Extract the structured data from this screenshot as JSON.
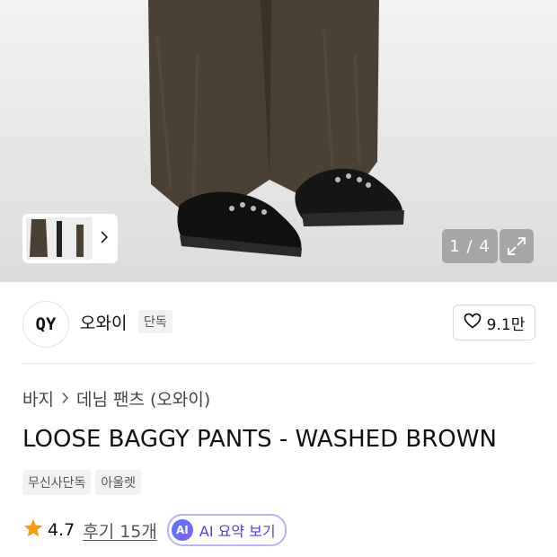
{
  "gallery": {
    "counter": "1 / 4",
    "thumbnail_icon": "product-thumbnail",
    "next_icon": "chevron-right-icon",
    "expand_icon": "expand-icon"
  },
  "brand": {
    "logo_text": "QY",
    "name": "오와이",
    "badge": "단독",
    "like_count": "9.1만",
    "like_icon": "heart-icon"
  },
  "breadcrumb": {
    "items": [
      "바지",
      "데님 팬츠 (오와이)"
    ]
  },
  "product": {
    "title": "LOOSE BAGGY PANTS - WASHED BROWN",
    "tags": [
      "무신사단독",
      "아울렛"
    ]
  },
  "rating": {
    "score": "4.7",
    "reviews": "후기 15개",
    "star_color": "#f59e0b"
  },
  "ai_summary": {
    "badge": "AI",
    "label": "AI 요약 보기",
    "accent": "#4a3df0"
  }
}
